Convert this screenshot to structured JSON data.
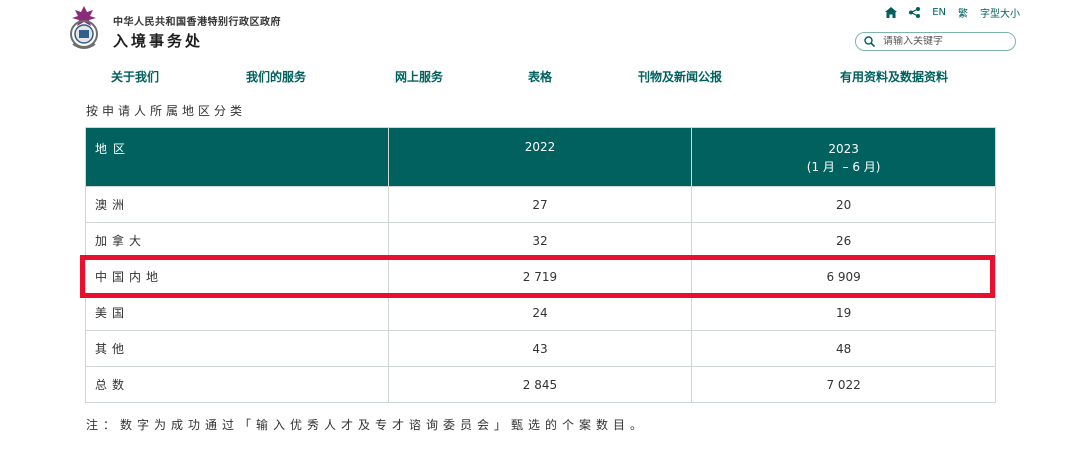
{
  "header": {
    "gov_title": "中华人民共和国香港特别行政区政府",
    "dept_title": "入境事务处",
    "tools": {
      "lang_en": "EN",
      "lang_trad": "繁",
      "font_size": "字型大小"
    },
    "search": {
      "placeholder": "请输入关键字"
    }
  },
  "nav": {
    "items": [
      {
        "label": "关于我们"
      },
      {
        "label": "我们的服务"
      },
      {
        "label": "网上服务"
      },
      {
        "label": "表格"
      },
      {
        "label": "刊物及新闻公报"
      },
      {
        "label": "有用资料及数据资料"
      }
    ]
  },
  "section_title": "按申请人所属地区分类",
  "table": {
    "headers": {
      "region": "地区",
      "y2022": "2022",
      "y2023": "2023",
      "y2023_sub": "(1 月  – 6 月)"
    },
    "rows": [
      {
        "region": "澳洲",
        "v2022": "27",
        "v2023": "20"
      },
      {
        "region": "加拿大",
        "v2022": "32",
        "v2023": "26"
      },
      {
        "region": "中国内地",
        "v2022": "2 719",
        "v2023": "6 909"
      },
      {
        "region": "美国",
        "v2022": "24",
        "v2023": "19"
      },
      {
        "region": "其他",
        "v2022": "43",
        "v2023": "48"
      },
      {
        "region": "总数",
        "v2022": "2 845",
        "v2023": "7 022"
      }
    ]
  },
  "footnote": "注：数字为成功通过「输入优秀人才及专才谘询委员会」甄选的个案数目。",
  "colors": {
    "brand": "#00615f",
    "highlight": "#e8102e"
  }
}
